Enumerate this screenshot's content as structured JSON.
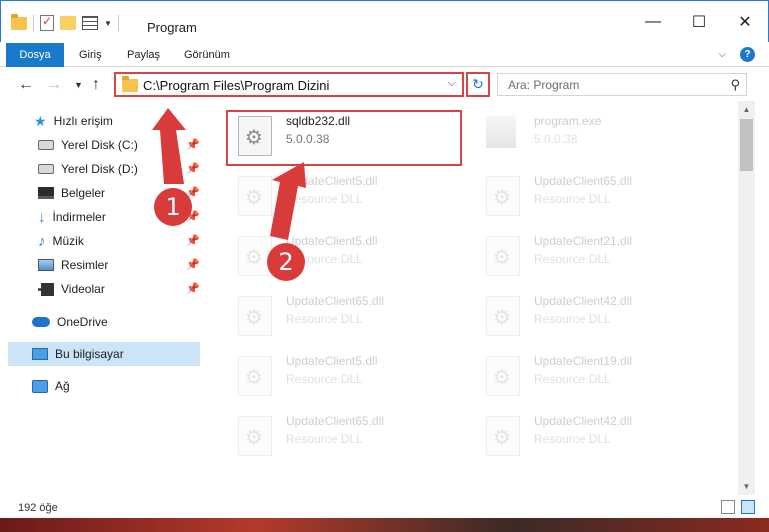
{
  "window": {
    "title": "Program",
    "minimize_glyph": "—",
    "maximize_glyph": "☐",
    "close_glyph": "✕"
  },
  "ribbon": {
    "tabs": [
      "Dosya",
      "Giriş",
      "Paylaş",
      "Görünüm"
    ],
    "help_glyph": "?"
  },
  "address_bar": {
    "path": "C:\\Program Files\\Program Dizini",
    "search_placeholder": "Ara: Program"
  },
  "navigation": {
    "quick_access": "Hızlı erişim",
    "items": [
      {
        "label": "Yerel Disk (C:)",
        "icon": "drive-icon"
      },
      {
        "label": "Yerel Disk (D:)",
        "icon": "drive-icon"
      },
      {
        "label": "Belgeler",
        "icon": "desktop-icon"
      },
      {
        "label": "İndirmeler",
        "icon": "download-icon"
      },
      {
        "label": "Müzik",
        "icon": "music-icon"
      },
      {
        "label": "Resimler",
        "icon": "pictures-icon"
      },
      {
        "label": "Videolar",
        "icon": "videos-icon"
      }
    ],
    "onedrive": "OneDrive",
    "this_pc": "Bu bilgisayar",
    "network": "Ağ"
  },
  "files": [
    {
      "name": "sqldb232.dll",
      "sub": "5.0.0.38",
      "highlighted": true
    },
    {
      "name": "program.exe",
      "sub": "5.0.0.38",
      "faded": true
    },
    {
      "name": "UpdateClient5.dll",
      "sub": "Resource DLL",
      "faded": true
    },
    {
      "name": "UpdateClient65.dll",
      "sub": "Resource DLL",
      "faded": true
    },
    {
      "name": "UpdateClient5.dll",
      "sub": "Resource DLL",
      "faded": true
    },
    {
      "name": "UpdateClient21.dll",
      "sub": "Resource DLL",
      "faded": true
    },
    {
      "name": "UpdateClient65.dll",
      "sub": "Resource DLL",
      "faded": true
    },
    {
      "name": "UpdateClient42.dll",
      "sub": "Resource DLL",
      "faded": true
    },
    {
      "name": "UpdateClient5.dll",
      "sub": "Resource DLL",
      "faded": true
    },
    {
      "name": "UpdateClient19.dll",
      "sub": "Resource DLL",
      "faded": true
    },
    {
      "name": "UpdateClient65.dll",
      "sub": "Resource DLL",
      "faded": true
    },
    {
      "name": "UpdateClient42.dll",
      "sub": "Resource DLL",
      "faded": true
    }
  ],
  "status": {
    "item_count": "192 öğe"
  },
  "annotations": {
    "callout_1": "1",
    "callout_2": "2"
  },
  "colors": {
    "accent": "#1979ca",
    "highlight_red": "#d84343",
    "selected_bg": "#cce4f7"
  }
}
